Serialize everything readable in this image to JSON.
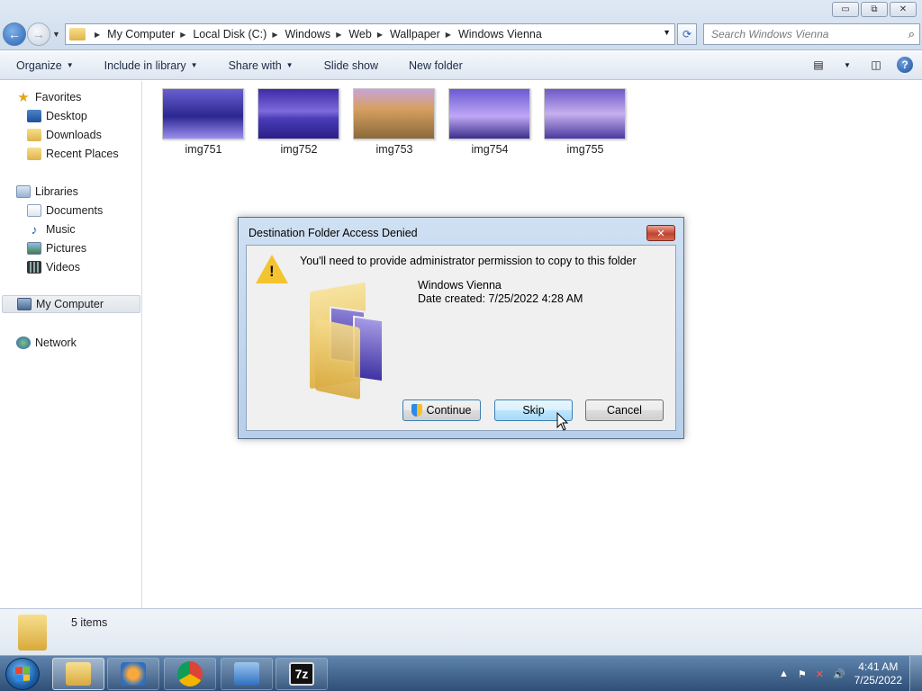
{
  "window": {
    "controls": [
      "▭",
      "⧉",
      "✕"
    ]
  },
  "address": {
    "crumbs": [
      "My Computer",
      "Local Disk (C:)",
      "Windows",
      "Web",
      "Wallpaper",
      "Windows Vienna"
    ]
  },
  "search": {
    "placeholder": "Search Windows Vienna"
  },
  "toolbar": {
    "organize": "Organize",
    "include_in_library": "Include in library",
    "share_with": "Share with",
    "slide_show": "Slide show",
    "new_folder": "New folder"
  },
  "nav": {
    "favorites": "Favorites",
    "desktop": "Desktop",
    "downloads": "Downloads",
    "recent_places": "Recent Places",
    "libraries": "Libraries",
    "documents": "Documents",
    "music": "Music",
    "pictures": "Pictures",
    "videos": "Videos",
    "my_computer": "My Computer",
    "network": "Network"
  },
  "files": [
    {
      "name": "img751",
      "colors": [
        "#6a5fd0",
        "#2b2790",
        "#9b8ff0"
      ]
    },
    {
      "name": "img752",
      "colors": [
        "#3f2aa8",
        "#7d6bdc",
        "#4a3cb8"
      ]
    },
    {
      "name": "img753",
      "colors": [
        "#c9a3d8",
        "#d6a060",
        "#8a6a3a"
      ]
    },
    {
      "name": "img754",
      "colors": [
        "#6b5ad2",
        "#bfa7f5",
        "#3b2f8a"
      ]
    },
    {
      "name": "img755",
      "colors": [
        "#6e58c8",
        "#c6b0ee",
        "#4a3aa0"
      ]
    }
  ],
  "details": {
    "count": "5 items"
  },
  "dialog": {
    "title": "Destination Folder Access Denied",
    "close": "✕",
    "message": "You'll need to provide administrator permission to copy to this folder",
    "folder_name": "Windows Vienna",
    "date_created": "Date created: 7/25/2022 4:28 AM",
    "continue": "Continue",
    "skip": "Skip",
    "cancel": "Cancel"
  },
  "taskbar": {
    "time": "4:41 AM",
    "date": "7/25/2022",
    "tray_arrow": "▲"
  }
}
